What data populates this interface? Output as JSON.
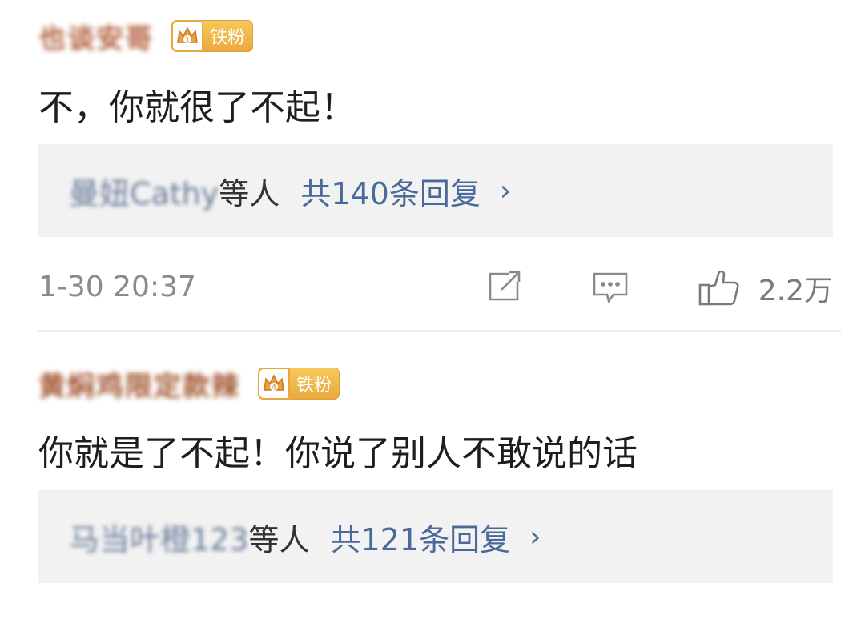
{
  "comments": [
    {
      "username": "也谈安哥",
      "badge_label": "铁粉",
      "badge_level": "1",
      "text": "不，你就很了不起！",
      "reply_preview": {
        "names": "曼妞Cathy",
        "names_suffix": "等人",
        "count_text": "共140条回复",
        "arrow": "›"
      },
      "timestamp": "1-30 20:37",
      "like_count": "2.2万"
    },
    {
      "username": "黄焖鸡限定款辣",
      "badge_label": "铁粉",
      "badge_level": "4",
      "text": "你就是了不起！你说了别人不敢说的话",
      "reply_preview": {
        "names": "马当叶橙123",
        "names_suffix": "等人",
        "count_text": "共121条回复",
        "arrow": "›"
      }
    }
  ],
  "icons": {
    "share": "share-icon",
    "comment": "comment-icon",
    "like": "thumbs-up-icon",
    "crown": "crown-icon"
  },
  "colors": {
    "badge_gold": "#e9a83c",
    "username": "#b05a38",
    "reply_link": "#4a6a9a",
    "reply_bg": "#f2f2f2"
  }
}
